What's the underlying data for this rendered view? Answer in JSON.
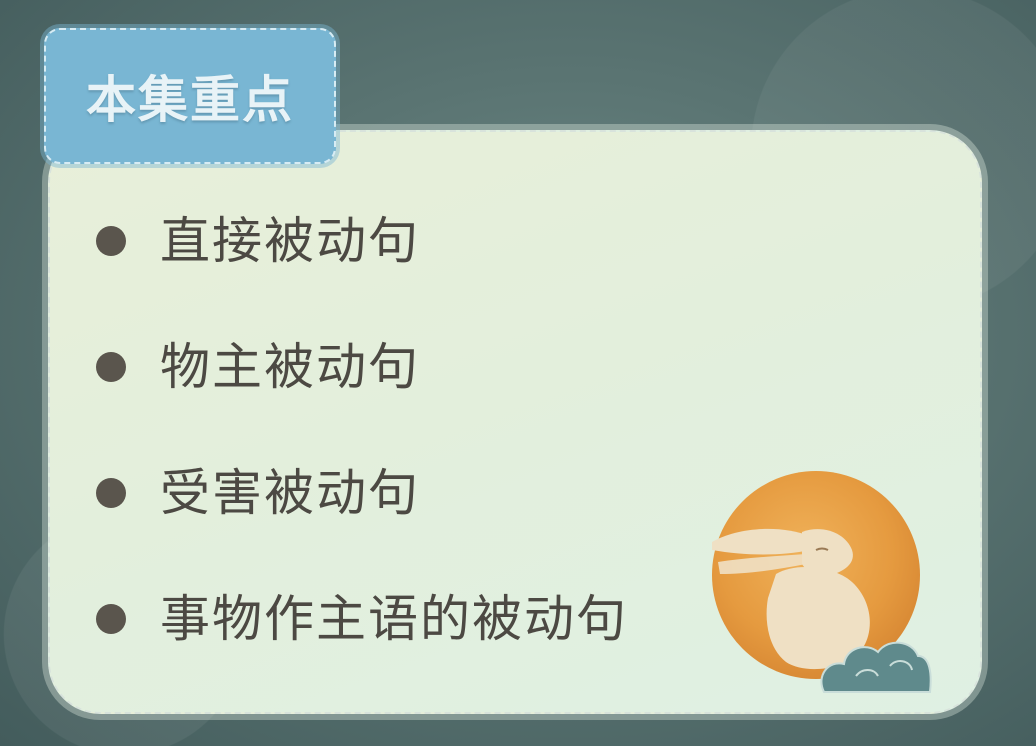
{
  "header": {
    "title": "本集重点"
  },
  "points": [
    {
      "label": "直接被动句"
    },
    {
      "label": "物主被动句"
    },
    {
      "label": "受害被动句"
    },
    {
      "label": "事物作主语的被动句"
    }
  ],
  "decoration": {
    "icon": "moon-rabbit-icon",
    "moon_color": "#e59a3f",
    "cloud_color": "#5f8a8c"
  }
}
